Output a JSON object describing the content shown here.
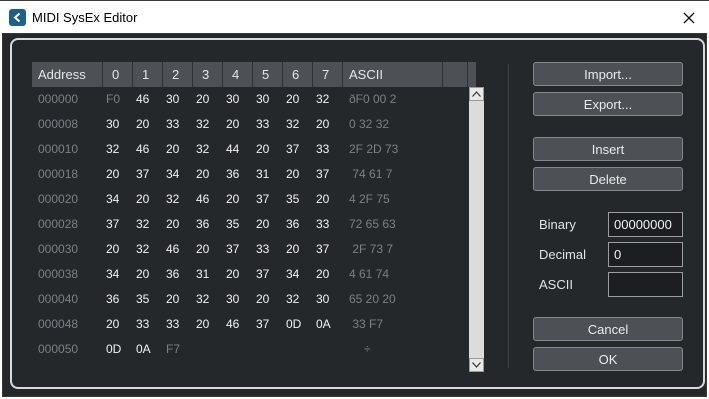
{
  "window": {
    "title": "MIDI SysEx Editor"
  },
  "colors": {
    "background": "#25282b",
    "header": "#4d5156",
    "value_text": "#f1f2f3",
    "dim_text": "#7b8086",
    "icon": "#1f5f8a"
  },
  "table": {
    "headers": [
      "Address",
      "0",
      "1",
      "2",
      "3",
      "4",
      "5",
      "6",
      "7",
      "ASCII"
    ],
    "rows": [
      {
        "address": "000000",
        "bytes": [
          "F0",
          "46",
          "30",
          "20",
          "30",
          "30",
          "20",
          "32"
        ],
        "ascii": "ðF0 00 2"
      },
      {
        "address": "000008",
        "bytes": [
          "30",
          "20",
          "33",
          "32",
          "20",
          "33",
          "32",
          "20"
        ],
        "ascii": "0 32 32"
      },
      {
        "address": "000010",
        "bytes": [
          "32",
          "46",
          "20",
          "32",
          "44",
          "20",
          "37",
          "33"
        ],
        "ascii": "2F 2D 73"
      },
      {
        "address": "000018",
        "bytes": [
          "20",
          "37",
          "34",
          "20",
          "36",
          "31",
          "20",
          "37"
        ],
        "ascii": " 74 61 7"
      },
      {
        "address": "000020",
        "bytes": [
          "34",
          "20",
          "32",
          "46",
          "20",
          "37",
          "35",
          "20"
        ],
        "ascii": "4 2F 75"
      },
      {
        "address": "000028",
        "bytes": [
          "37",
          "32",
          "20",
          "36",
          "35",
          "20",
          "36",
          "33"
        ],
        "ascii": "72 65 63"
      },
      {
        "address": "000030",
        "bytes": [
          "20",
          "32",
          "46",
          "20",
          "37",
          "33",
          "20",
          "37"
        ],
        "ascii": " 2F 73 7"
      },
      {
        "address": "000038",
        "bytes": [
          "34",
          "20",
          "36",
          "31",
          "20",
          "37",
          "34",
          "20"
        ],
        "ascii": "4 61 74"
      },
      {
        "address": "000040",
        "bytes": [
          "36",
          "35",
          "20",
          "32",
          "30",
          "20",
          "32",
          "30"
        ],
        "ascii": "65 20 20"
      },
      {
        "address": "000048",
        "bytes": [
          "20",
          "33",
          "33",
          "20",
          "46",
          "37",
          "0D",
          "0A"
        ],
        "ascii": " 33 F7"
      },
      {
        "address": "000050",
        "bytes": [
          "0D",
          "0A",
          "F7",
          "",
          "",
          "",
          "",
          ""
        ],
        "ascii": "÷"
      }
    ]
  },
  "buttons": {
    "import": "Import...",
    "export": "Export...",
    "insert": "Insert",
    "delete": "Delete",
    "cancel": "Cancel",
    "ok": "OK"
  },
  "fields": {
    "binary": {
      "label": "Binary",
      "value": "00000000"
    },
    "decimal": {
      "label": "Decimal",
      "value": "0"
    },
    "ascii": {
      "label": "ASCII",
      "value": ""
    }
  }
}
